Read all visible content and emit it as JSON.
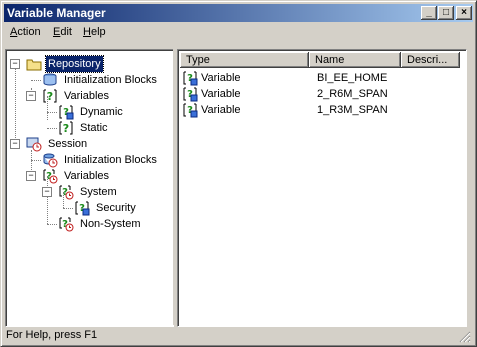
{
  "window": {
    "title": "Variable Manager"
  },
  "titlebar_buttons": [
    "_",
    "□",
    "×"
  ],
  "menu": [
    {
      "label": "Action",
      "mnemonic": "A",
      "rest": "ction"
    },
    {
      "label": "Edit",
      "mnemonic": "E",
      "rest": "dit"
    },
    {
      "label": "Help",
      "mnemonic": "H",
      "rest": "elp"
    }
  ],
  "tree": [
    {
      "label": "Repository",
      "icon": "folder-icon",
      "expander": "−",
      "selected": true
    },
    {
      "label": "Initialization Blocks",
      "icon": "database-icon"
    },
    {
      "label": "Variables",
      "icon": "variable-icon",
      "expander": "−"
    },
    {
      "label": "Dynamic",
      "icon": "variable-dynamic-icon"
    },
    {
      "label": "Static",
      "icon": "variable-icon"
    },
    {
      "label": "Session",
      "icon": "session-icon",
      "expander": "−"
    },
    {
      "label": "Initialization Blocks",
      "icon": "session-database-icon"
    },
    {
      "label": "Variables",
      "icon": "session-variable-icon",
      "expander": "−"
    },
    {
      "label": "System",
      "icon": "session-variable-icon",
      "expander": "−"
    },
    {
      "label": "Security",
      "icon": "variable-dynamic-icon"
    },
    {
      "label": "Non-System",
      "icon": "session-variable-icon"
    }
  ],
  "list": {
    "columns": [
      "Type",
      "Name",
      "Descri..."
    ],
    "rows": [
      {
        "type": "Variable",
        "name": "BI_EE_HOME"
      },
      {
        "type": "Variable",
        "name": "2_R6M_SPAN"
      },
      {
        "type": "Variable",
        "name": "1_R3M_SPAN"
      }
    ]
  },
  "status": {
    "text": "For Help, press F1"
  }
}
